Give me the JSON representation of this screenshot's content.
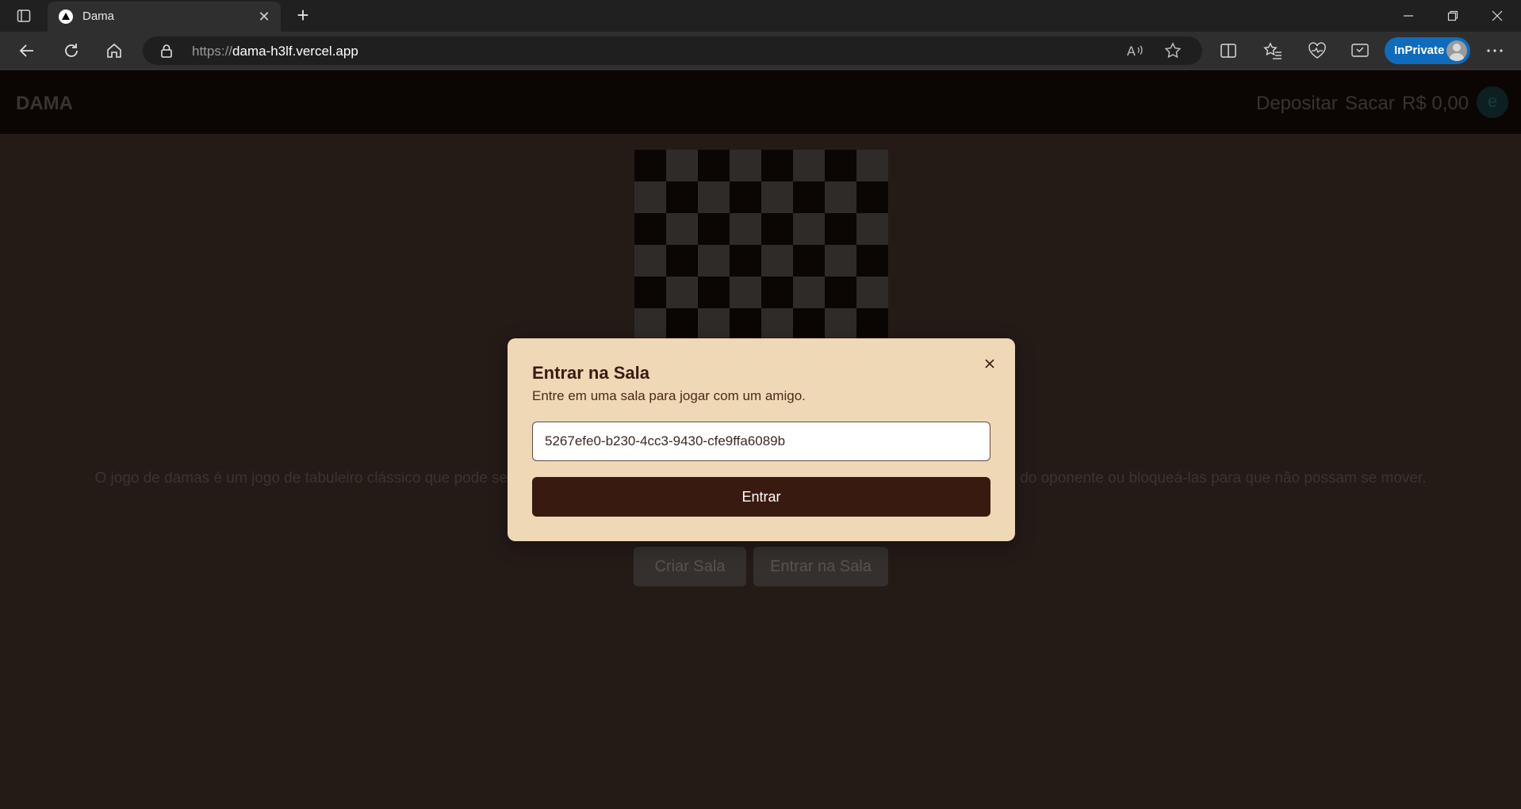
{
  "browser": {
    "tab_title": "Dama",
    "url_scheme": "https://",
    "url_host": "dama-h3lf.vercel.app",
    "inprivate_label": "InPrivate"
  },
  "app": {
    "brand": "DAMA",
    "nav": {
      "deposit": "Depositar",
      "withdraw": "Sacar",
      "balance": "R$ 0,00",
      "avatar_initial": "e"
    },
    "description_left": "O jogo de damas é um jogo de tabuleiro clássico que pode se",
    "description_right": "do oponente ou bloqueá-las para que não possam se mover.",
    "buttons": {
      "create_room": "Criar Sala",
      "join_room": "Entrar na Sala"
    }
  },
  "modal": {
    "title": "Entrar na Sala",
    "subtitle": "Entre em uma sala para jogar com um amigo.",
    "room_id_value": "5267efe0-b230-4cc3-9430-cfe9ffa6089b",
    "submit_label": "Entrar"
  },
  "colors": {
    "modal_bg": "#efd8b6",
    "primary_button": "#391a10",
    "page_bg": "#241b17",
    "header_bg": "#0b0604"
  }
}
